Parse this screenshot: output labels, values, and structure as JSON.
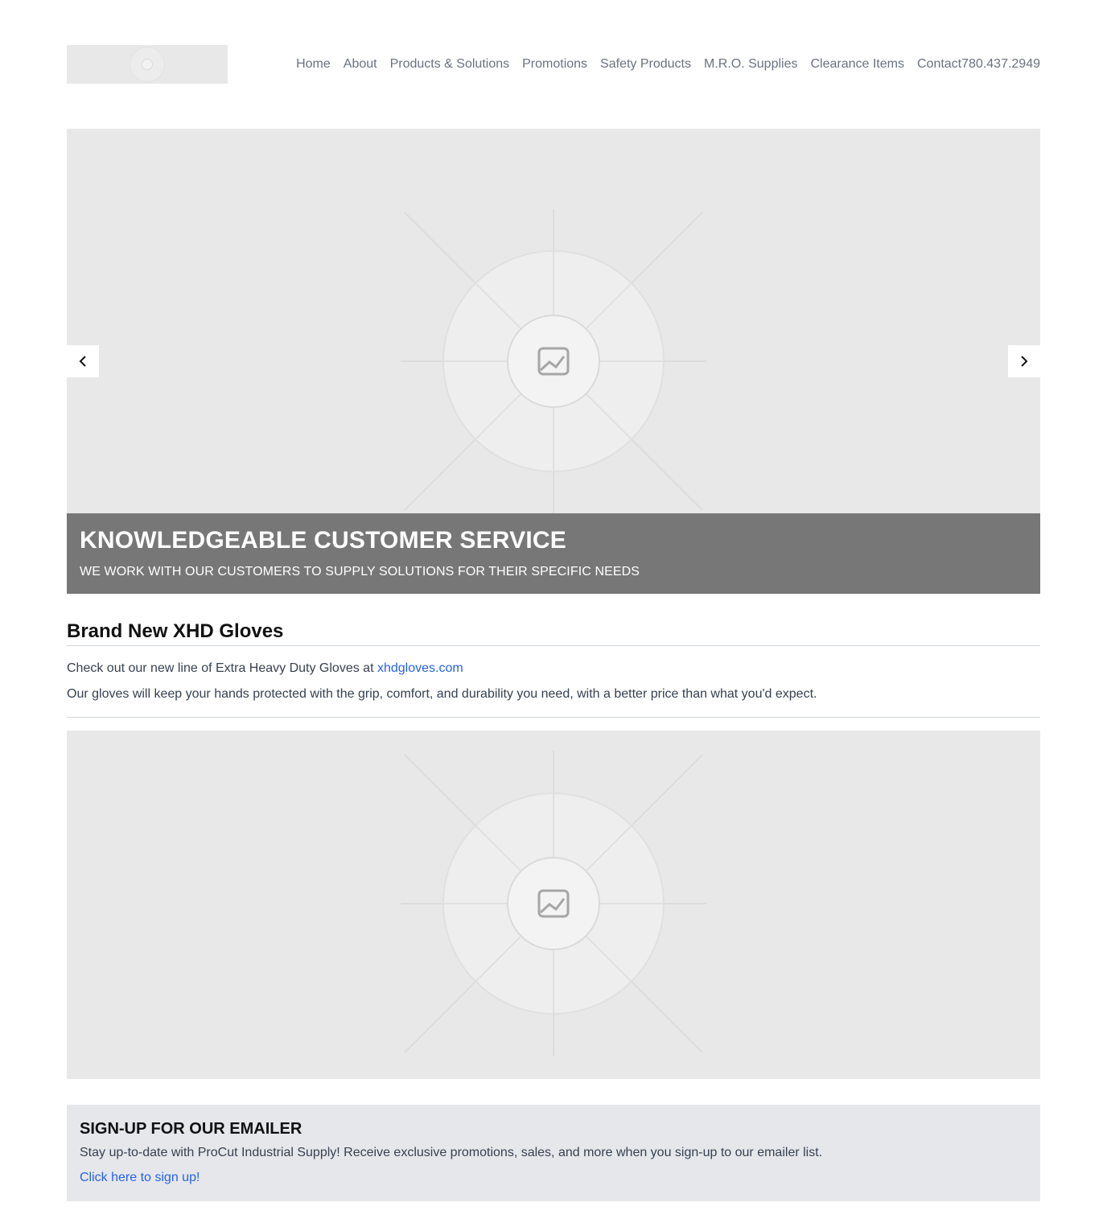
{
  "header": {
    "logo": "logo-placeholder",
    "nav": [
      {
        "label": "Home"
      },
      {
        "label": "About"
      },
      {
        "label": "Products & Solutions"
      },
      {
        "label": "Promotions"
      },
      {
        "label": "Safety Products"
      },
      {
        "label": "M.R.O. Supplies"
      },
      {
        "label": "Clearance Items"
      },
      {
        "label": "Contact"
      }
    ],
    "phone": "780.437.2949"
  },
  "carousel": {
    "image_icon": "image-placeholder-icon",
    "prev_icon": "chevron-left-icon",
    "next_icon": "chevron-right-icon",
    "caption_title": "KNOWLEDGEABLE CUSTOMER SERVICE",
    "caption_text": "WE WORK WITH OUR CUSTOMERS TO SUPPLY SOLUTIONS FOR THEIR SPECIFIC NEEDS",
    "caption_bg": "#777777"
  },
  "article": {
    "title": "Brand New XHD Gloves",
    "line1_prefix": "Check out our new line of Extra Heavy Duty Gloves at ",
    "line1_link": "xhdgloves.com",
    "line2": "Our gloves will keep your hands protected with the grip, comfort, and durability you need, with a better price than what you'd expect.",
    "link_color": "#2563eb"
  },
  "signup": {
    "title": "SIGN-UP FOR OUR EMAILER",
    "text": "Stay up-to-date with ProCut Industrial Supply! Receive exclusive promotions, sales, and more when you sign-up to our emailer list.",
    "link": "Click here to sign up!"
  }
}
